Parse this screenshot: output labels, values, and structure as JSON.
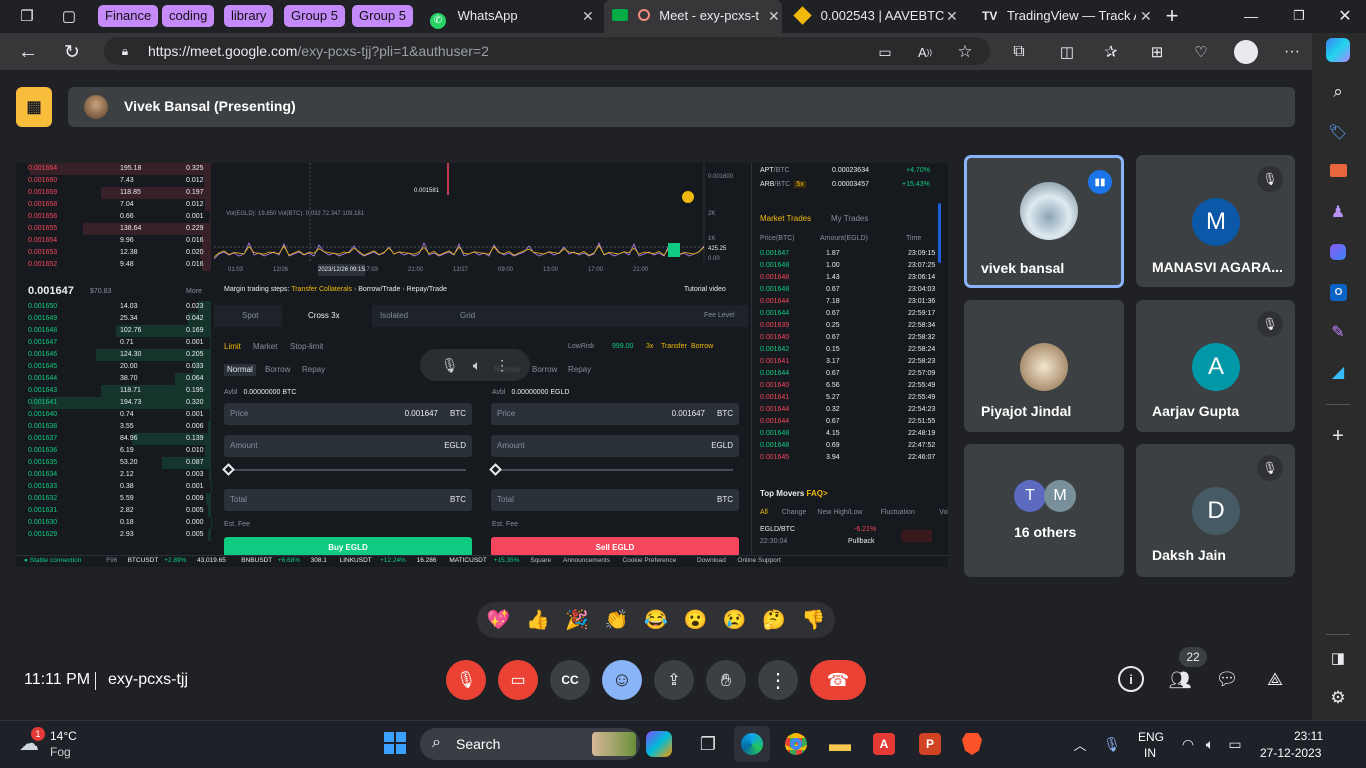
{
  "browser": {
    "tab_groups": [
      {
        "label": "Finance",
        "color": "#c58af9"
      },
      {
        "label": "coding",
        "color": "#c58af9"
      },
      {
        "label": "library",
        "color": "#c58af9"
      },
      {
        "label": "Group 5",
        "color": "#c58af9"
      },
      {
        "label": "Group 5",
        "color": "#c58af9"
      }
    ],
    "tabs": [
      {
        "label": "WhatsApp",
        "icon": "whatsapp-icon"
      },
      {
        "label": "Meet - exy-pcxs-t",
        "icon": "google-meet-icon",
        "active": true
      },
      {
        "label": "0.002543 | AAVEBTC",
        "icon": "binance-icon"
      },
      {
        "label": "TradingView — Track A",
        "icon": "tradingview-icon"
      }
    ],
    "url_host": "https://meet.google.com",
    "url_path": "/exy-pcxs-tjj?pli=1&authuser=2"
  },
  "meet": {
    "presenter_bar": "Vivek Bansal (Presenting)",
    "meeting_code": "exy-pcxs-tjj",
    "time": "11:11 PM",
    "participant_count": "22",
    "participants": [
      {
        "name": "vivek bansal",
        "speaking": true
      },
      {
        "name": "MANASVI AGARA...",
        "initial": "M",
        "color": "#0b57a8",
        "muted": true
      },
      {
        "name": "Piyajot Jindal",
        "muted": true
      },
      {
        "name": "Aarjav Gupta",
        "initial": "A",
        "color": "#0097a7",
        "muted": true
      },
      {
        "name": "16 others",
        "initials": [
          "T",
          "M"
        ]
      },
      {
        "name": "Daksh Jain",
        "initial": "D",
        "color": "#455a64",
        "muted": true
      }
    ],
    "reactions": [
      "💖",
      "👍",
      "🎉",
      "👏",
      "😂",
      "😮",
      "😢",
      "🤔",
      "👎"
    ]
  },
  "shared_screen": {
    "asks": [
      [
        "0.001664",
        "195.18",
        "0.325"
      ],
      [
        "0.001660",
        "7.43",
        "0.012"
      ],
      [
        "0.001659",
        "118.85",
        "0.197"
      ],
      [
        "0.001658",
        "7.04",
        "0.012"
      ],
      [
        "0.001656",
        "0.66",
        "0.001"
      ],
      [
        "0.001655",
        "138.64",
        "0.229"
      ],
      [
        "0.001654",
        "9.96",
        "0.016"
      ],
      [
        "0.001653",
        "12.38",
        "0.020"
      ],
      [
        "0.001652",
        "9.48",
        "0.016"
      ]
    ],
    "last_price": "0.001647",
    "last_usd": "$70.83",
    "more": "More",
    "bids": [
      [
        "0.001650",
        "14.03",
        "0.023"
      ],
      [
        "0.001649",
        "25.34",
        "0.042"
      ],
      [
        "0.001648",
        "102.76",
        "0.169"
      ],
      [
        "0.001647",
        "0.71",
        "0.001"
      ],
      [
        "0.001646",
        "124.30",
        "0.205"
      ],
      [
        "0.001645",
        "20.00",
        "0.033"
      ],
      [
        "0.001644",
        "38.70",
        "0.064"
      ],
      [
        "0.001643",
        "118.71",
        "0.195"
      ],
      [
        "0.001641",
        "194.73",
        "0.320"
      ],
      [
        "0.001640",
        "0.74",
        "0.001"
      ],
      [
        "0.001638",
        "3.55",
        "0.006"
      ],
      [
        "0.001637",
        "84.96",
        "0.139"
      ],
      [
        "0.001636",
        "6.19",
        "0.010"
      ],
      [
        "0.001635",
        "53.20",
        "0.087"
      ],
      [
        "0.001634",
        "2.12",
        "0.003"
      ],
      [
        "0.001633",
        "0.38",
        "0.001"
      ],
      [
        "0.001632",
        "5.59",
        "0.009"
      ],
      [
        "0.001631",
        "2.82",
        "0.005"
      ],
      [
        "0.001630",
        "0.18",
        "0.000"
      ],
      [
        "0.001629",
        "2.93",
        "0.005"
      ]
    ],
    "chart": {
      "vol_label": "Vol(EGLD): 19.850  Vol(BTC): 0.032  72.347  109.181",
      "price_marker": "0.001581",
      "y_labels": [
        "0.001600",
        "2K",
        "1K",
        "425.25",
        "0.00"
      ],
      "x_labels": [
        "01:03",
        "12/26",
        "2023/12/26 09:15",
        "17:03",
        "21:00",
        "12/27",
        "09:00",
        "13:00",
        "17:00",
        "21:00"
      ]
    },
    "margin_steps": {
      "label": "Margin trading steps:",
      "steps": [
        "Transfer Collaterals",
        "Borrow/Trade",
        "Repay/Trade"
      ],
      "tutorial": "Tutorial video"
    },
    "order_tabs": [
      "Spot",
      "Cross 3x",
      "Isolated",
      "Grid"
    ],
    "fee_level": "Fee Level",
    "order_types": [
      "Limit",
      "Market",
      "Stop-limit"
    ],
    "lowrisk": "LowRisk",
    "risk_value": "999.00",
    "leverage": "3x",
    "transfer": "Transfer",
    "borrow": "Borrow",
    "modes": [
      "Normal",
      "Borrow",
      "Repay"
    ],
    "buy": {
      "avbl_label": "Avbl",
      "avbl": "0.00000000 BTC",
      "price_label": "Price",
      "price": "0.001647",
      "price_unit": "BTC",
      "amount_label": "Amount",
      "amount_unit": "EGLD",
      "total_label": "Total",
      "total_unit": "BTC",
      "fee_label": "Est. Fee",
      "button": "Buy EGLD"
    },
    "sell": {
      "avbl_label": "Avbl",
      "avbl": "0.00000000 EGLD",
      "price_label": "Price",
      "price": "0.001647",
      "price_unit": "BTC",
      "amount_label": "Amount",
      "amount_unit": "EGLD",
      "total_label": "Total",
      "total_unit": "BTC",
      "fee_label": "Est. Fee",
      "button": "Sell EGLD"
    },
    "tickers": [
      {
        "sym": "APT",
        "quote": "/BTC",
        "price": "0.00023634",
        "chg": "+4.70%"
      },
      {
        "sym": "ARB",
        "quote": "/BTC",
        "badge": "5x",
        "price": "0.00003457",
        "chg": "+15.43%"
      }
    ],
    "trades_tabs": [
      "Market Trades",
      "My Trades"
    ],
    "trades_headers": [
      "Price(BTC)",
      "Amount(EGLD)",
      "Time"
    ],
    "trades": [
      [
        "0.001647",
        "1.87",
        "23:09:15",
        "g"
      ],
      [
        "0.001648",
        "1.00",
        "23:07:25",
        "g"
      ],
      [
        "0.001648",
        "1.43",
        "23:06:14",
        "r"
      ],
      [
        "0.001648",
        "0.67",
        "23:04:03",
        "g"
      ],
      [
        "0.001644",
        "7.18",
        "23:01:36",
        "r"
      ],
      [
        "0.001644",
        "0.67",
        "22:59:17",
        "g"
      ],
      [
        "0.001639",
        "0.25",
        "22:58:34",
        "r"
      ],
      [
        "0.001640",
        "0.67",
        "22:58:32",
        "r"
      ],
      [
        "0.001642",
        "0.15",
        "22:58:24",
        "g"
      ],
      [
        "0.001641",
        "3.17",
        "22:58:23",
        "r"
      ],
      [
        "0.001644",
        "0.67",
        "22:57:09",
        "g"
      ],
      [
        "0.001640",
        "6.56",
        "22:55:49",
        "r"
      ],
      [
        "0.001641",
        "5.27",
        "22:55:49",
        "r"
      ],
      [
        "0.001644",
        "0.32",
        "22:54:23",
        "r"
      ],
      [
        "0.001644",
        "0.67",
        "22:51:55",
        "r"
      ],
      [
        "0.001648",
        "4.15",
        "22:48:19",
        "g"
      ],
      [
        "0.001648",
        "0.69",
        "22:47:52",
        "g"
      ],
      [
        "0.001645",
        "3.94",
        "22:46:07",
        "r"
      ]
    ],
    "top_movers": {
      "title": "Top Movers",
      "faq": "FAQ>",
      "tabs": [
        "All",
        "Change",
        "New High/Low",
        "Fluctuation",
        "Volume"
      ],
      "item_pair": "EGLD/BTC",
      "item_change": "-6.21%",
      "item_time": "22:30:04",
      "item_label": "Pullback"
    },
    "status_bar": {
      "connection": "Stable connection",
      "count": "F96",
      "items": [
        {
          "sym": "BTCUSDT",
          "chg": "+2.89%",
          "price": "43,019.65"
        },
        {
          "sym": "BNBUSDT",
          "chg": "+6.68%",
          "price": "308.1"
        },
        {
          "sym": "LINKUSDT",
          "chg": "+12.24%",
          "price": "16.286"
        },
        {
          "sym": "MATICUSDT",
          "chg": "+15.35%",
          "price": ""
        }
      ],
      "links": [
        "Square",
        "Announcements",
        "Cookie Preference",
        "Download",
        "Online Support"
      ]
    }
  },
  "taskbar": {
    "weather_badge": "1",
    "temp": "14°C",
    "condition": "Fog",
    "search": "Search",
    "lang_top": "ENG",
    "lang_bottom": "IN",
    "clock_time": "23:11",
    "clock_date": "27-12-2023"
  }
}
